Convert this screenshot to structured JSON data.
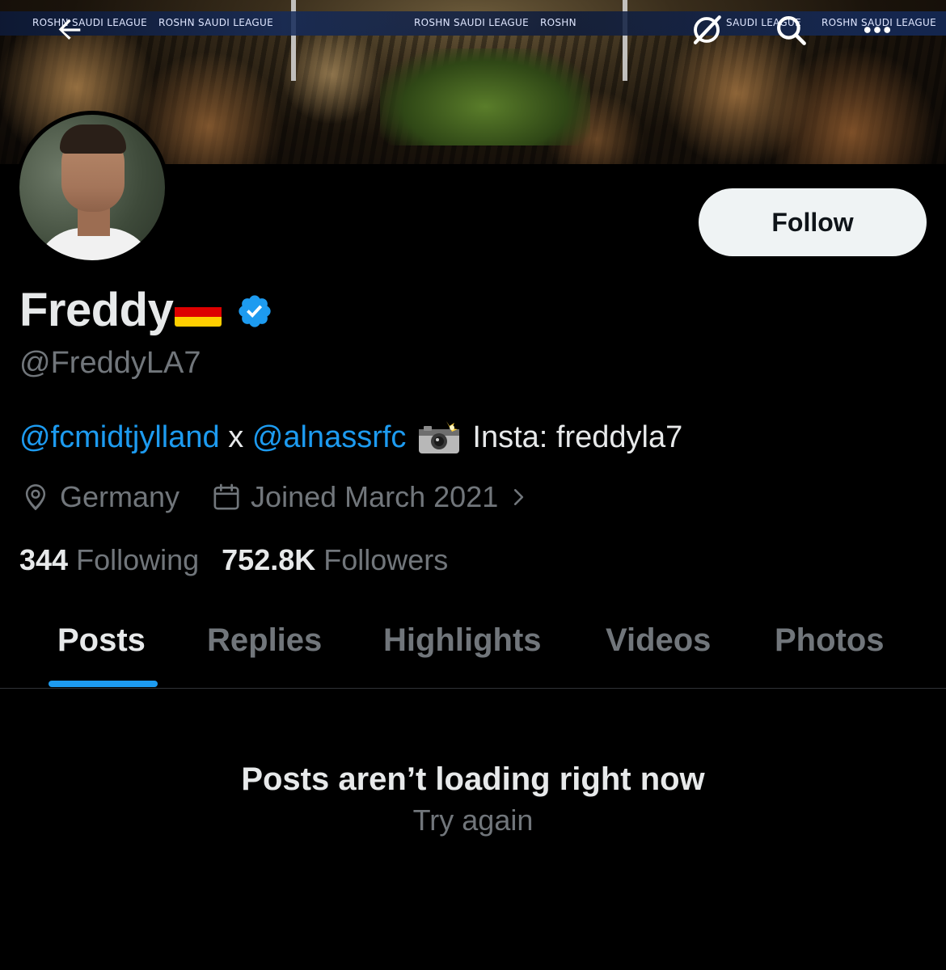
{
  "banner": {
    "ad_texts": [
      "ROSHN SAUDI LEAGUE",
      "ROSHN SAUDI LEAGUE",
      "ROSHN SAUDI LEAGUE",
      "ROSHN",
      "SAUDI LEAGUE",
      "ROSHN SAUDI LEAGUE"
    ]
  },
  "nav": {
    "back_icon": "arrow-left-icon",
    "grok_icon": "grok-icon",
    "search_icon": "search-icon",
    "more_icon": "more-horizontal-icon"
  },
  "profile": {
    "display_name": "Freddy",
    "flag": "germany-flag",
    "verified": true,
    "handle": "@FreddyLA7",
    "follow_label": "Follow"
  },
  "bio": {
    "mention_1": "@fcmidtjylland",
    "separator": " x ",
    "mention_2": "@alnassrfc",
    "camera_icon": "camera-flash-emoji",
    "insta": "Insta: freddyla7"
  },
  "meta": {
    "location": "Germany",
    "joined": "Joined March 2021"
  },
  "stats": {
    "following_count": "344",
    "following_label": "Following",
    "followers_count": "752.8K",
    "followers_label": "Followers"
  },
  "tabs": [
    {
      "label": "Posts",
      "active": true
    },
    {
      "label": "Replies",
      "active": false
    },
    {
      "label": "Highlights",
      "active": false
    },
    {
      "label": "Videos",
      "active": false
    },
    {
      "label": "Photos",
      "active": false
    }
  ],
  "error": {
    "title": "Posts aren’t loading right now",
    "retry": "Try again"
  },
  "colors": {
    "accent": "#1d9bf0",
    "background": "#000000",
    "text_primary": "#e7e9ea",
    "text_secondary": "#71767b"
  }
}
